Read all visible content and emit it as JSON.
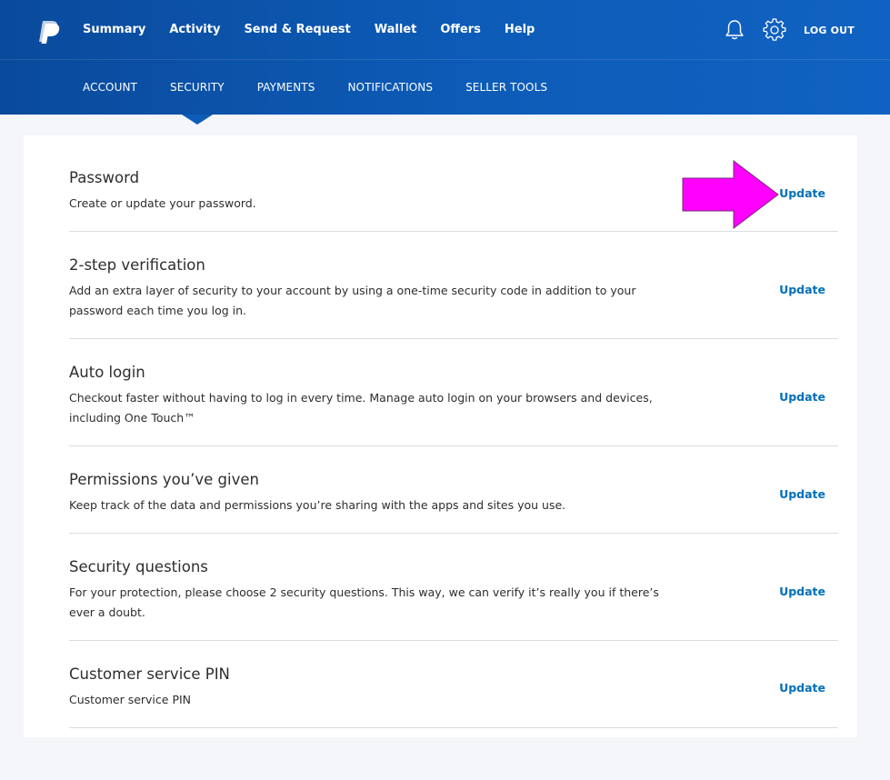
{
  "topnav": {
    "items": [
      "Summary",
      "Activity",
      "Send & Request",
      "Wallet",
      "Offers",
      "Help"
    ],
    "logout": "LOG OUT"
  },
  "subnav": {
    "items": [
      "ACCOUNT",
      "SECURITY",
      "PAYMENTS",
      "NOTIFICATIONS",
      "SELLER TOOLS"
    ],
    "active": "SECURITY"
  },
  "security": {
    "rows": [
      {
        "title": "Password",
        "desc": "Create or update your password.",
        "action": "Update"
      },
      {
        "title": "2-step verification",
        "desc": "Add an extra layer of security to your account by using a one-time security code in addition to your password each time you log in.",
        "action": "Update"
      },
      {
        "title": "Auto login",
        "desc": "Checkout faster without having to log in every time. Manage auto login on your browsers and devices, including One Touch™",
        "action": "Update"
      },
      {
        "title": "Permissions you’ve given",
        "desc": "Keep track of the data and permissions you’re sharing with the apps and sites you use.",
        "action": "Update"
      },
      {
        "title": "Security questions",
        "desc": "For your protection, please choose 2 security questions. This way, we can verify it’s really you if there’s ever a doubt.",
        "action": "Update"
      },
      {
        "title": "Customer service PIN",
        "desc": "Customer service PIN",
        "action": "Update"
      }
    ]
  },
  "colors": {
    "header": "#0d5cb8",
    "link": "#0070ba",
    "annotation_arrow": "#ff00ff"
  },
  "icons": [
    "paypal-logo-icon",
    "bell-icon",
    "gear-icon",
    "arrow-right-icon"
  ]
}
